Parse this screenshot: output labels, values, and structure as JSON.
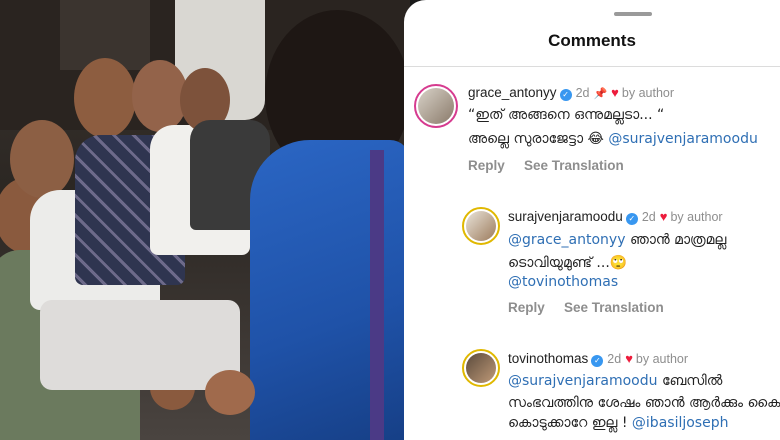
{
  "panel": {
    "title": "Comments"
  },
  "comments": [
    {
      "username": "grace_antonyy",
      "time": "2d",
      "pinned_icon": "pin-icon",
      "liked_by": "by author",
      "line1": "“ഇത് അങ്ങനെ ഒന്നുമല്ലടാ... “",
      "line2_text": "അല്ലെ സുരാജേട്ടാ 😂",
      "line2_mention": "@surajvenjaramoodu",
      "reply_label": "Reply",
      "translate_label": "See Translation"
    },
    {
      "username": "surajvenjaramoodu",
      "time": "2d",
      "liked_by": "by author",
      "line1_mention": "@grace_antonyy",
      "line1_text": "ഞാൻ മാത്രമല്ല",
      "line2_text": "ടൊവിയുമുണ്ട് ...🙄",
      "line3_mention": "@tovinothomas",
      "reply_label": "Reply",
      "translate_label": "See Translation"
    },
    {
      "username": "tovinothomas",
      "time": "2d",
      "liked_by": "by author",
      "line1_mention": "@surajvenjaramoodu",
      "line1_text": "ബേസിൽ",
      "line2_text": "സംഭവത്തിനു ശേഷം ഞാൻ ആർക്കും കൈ",
      "line3_text": "കൊടുക്കാറേ ഇല്ല !",
      "line3_mention": "@ibasiljoseph"
    }
  ],
  "colors": {
    "mention": "#2f6fb4",
    "heart": "#ed1c3c",
    "verified": "#3897f0",
    "secondary_text": "#8e8e8e"
  }
}
